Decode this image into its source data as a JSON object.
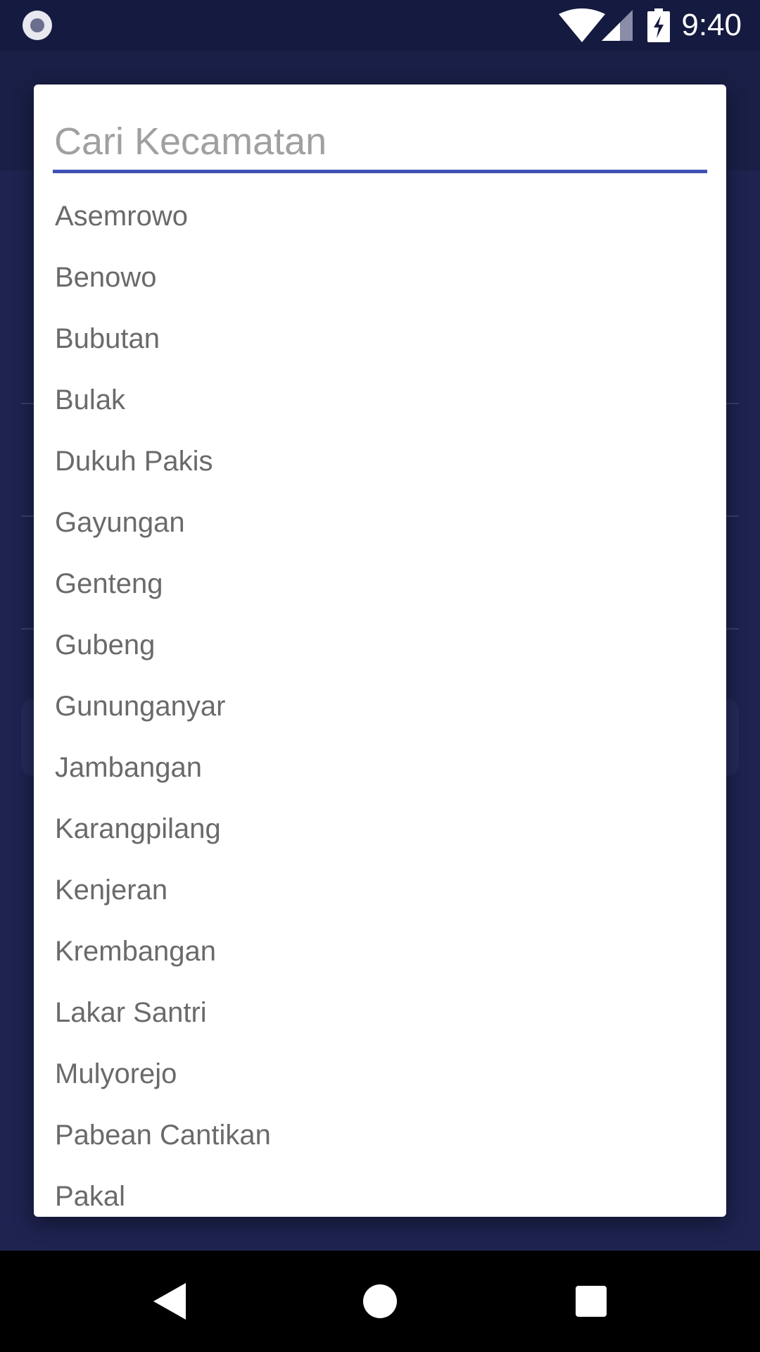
{
  "status_bar": {
    "time": "9:40",
    "icons": [
      "record-icon",
      "wifi-icon",
      "signal-icon",
      "battery-charging-icon"
    ]
  },
  "dialog": {
    "search": {
      "placeholder": "Cari Kecamatan",
      "value": ""
    },
    "items": [
      "Asemrowo",
      "Benowo",
      "Bubutan",
      "Bulak",
      "Dukuh Pakis",
      "Gayungan",
      "Genteng",
      "Gubeng",
      "Gununganyar",
      "Jambangan",
      "Karangpilang",
      "Kenjeran",
      "Krembangan",
      "Lakar Santri",
      "Mulyorejo",
      "Pabean Cantikan",
      "Pakal"
    ]
  },
  "nav_bar": {
    "icons": [
      "back-icon",
      "home-icon",
      "recents-icon"
    ]
  },
  "colors": {
    "accent": "#3f51b5",
    "status_bar": "#151a40",
    "app_background": "#1e2350",
    "list_text": "#6a6a6a"
  }
}
